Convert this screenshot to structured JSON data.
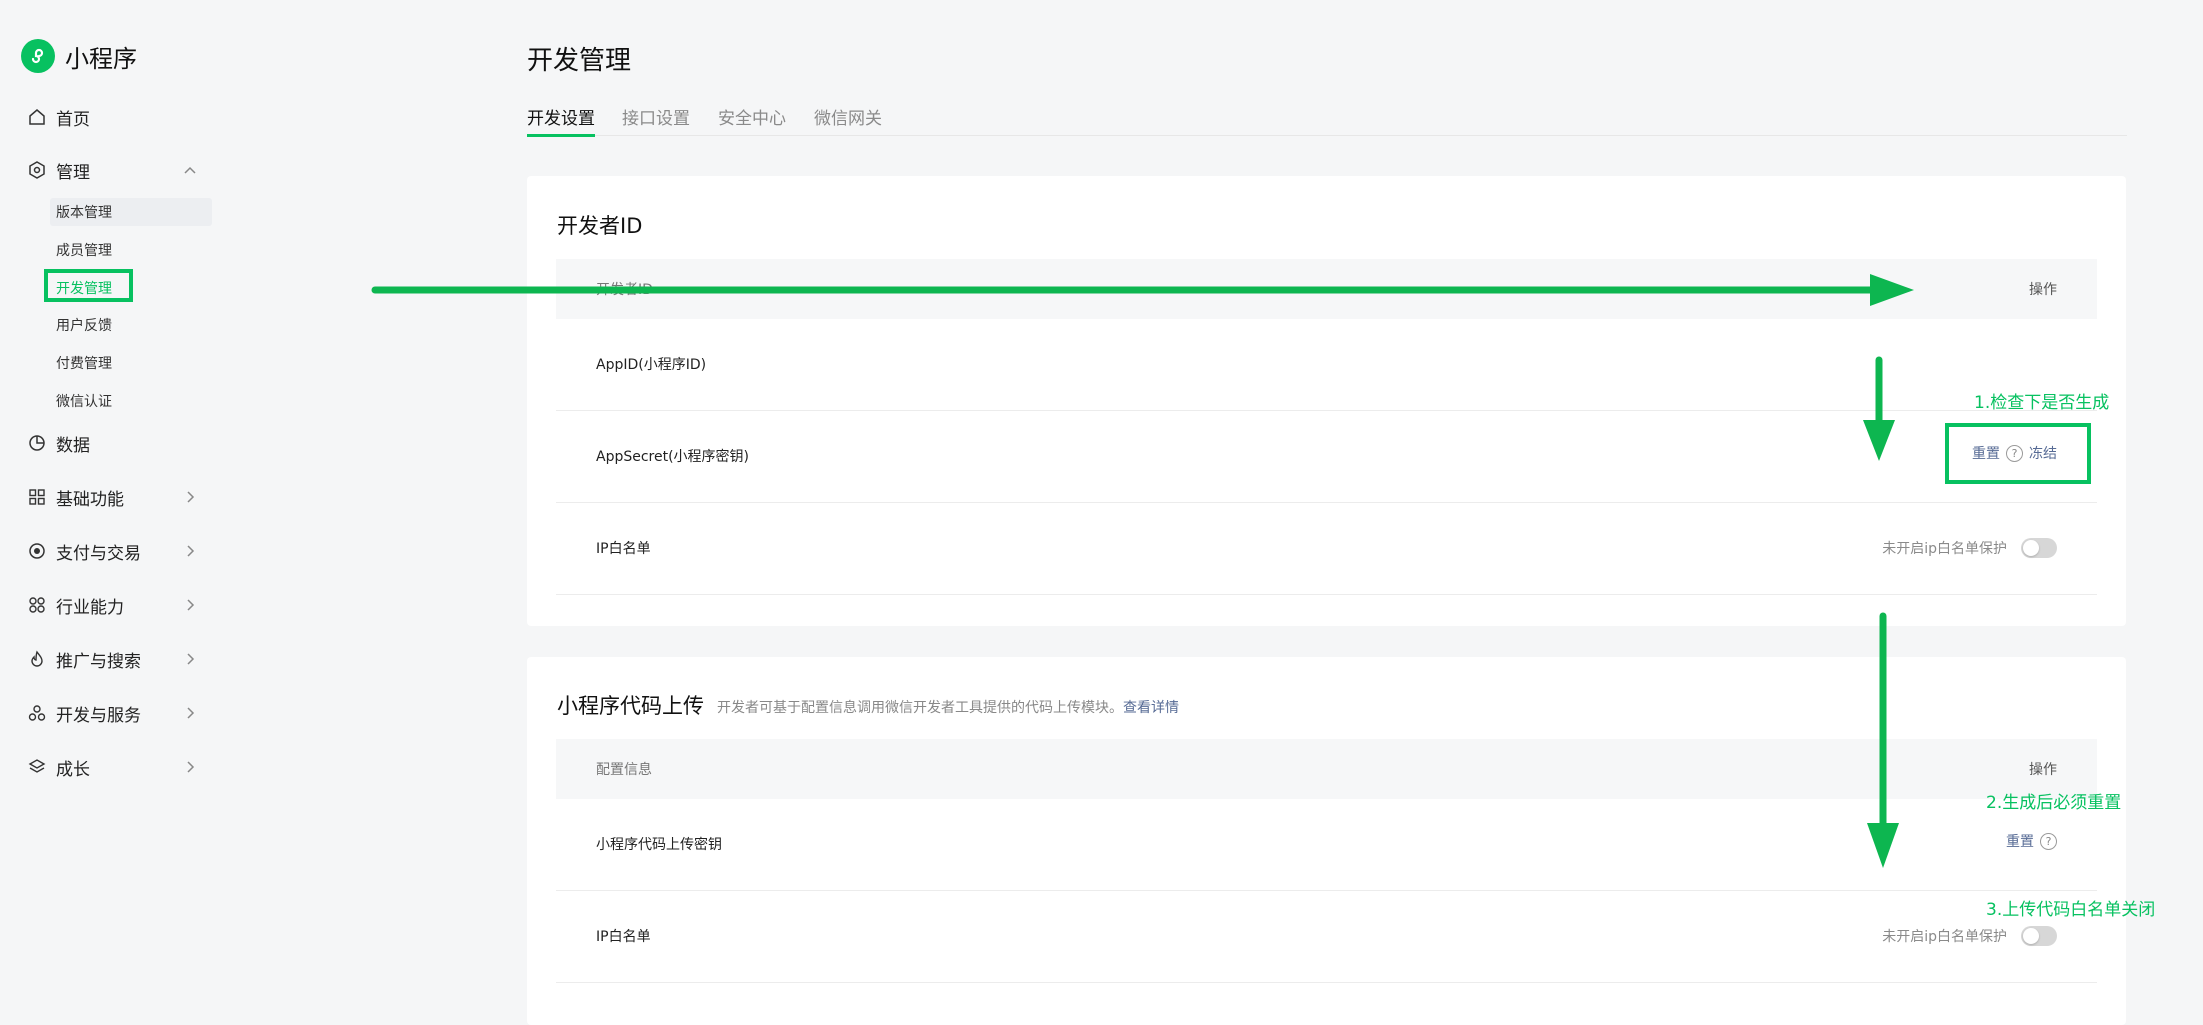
{
  "brand": {
    "name": "小程序"
  },
  "sidebar": {
    "items": [
      {
        "label": "首页",
        "icon": "home-icon"
      },
      {
        "label": "管理",
        "icon": "settings-hex-icon",
        "expanded": true
      },
      {
        "label": "数据",
        "icon": "pie-icon"
      },
      {
        "label": "基础功能",
        "icon": "grid-icon"
      },
      {
        "label": "支付与交易",
        "icon": "pay-icon"
      },
      {
        "label": "行业能力",
        "icon": "industry-icon"
      },
      {
        "label": "推广与搜索",
        "icon": "promote-icon"
      },
      {
        "label": "开发与服务",
        "icon": "dev-icon"
      },
      {
        "label": "成长",
        "icon": "growth-icon"
      }
    ],
    "sub_items": [
      "版本管理",
      "成员管理",
      "开发管理",
      "用户反馈",
      "付费管理",
      "微信认证"
    ]
  },
  "page": {
    "title": "开发管理"
  },
  "tabs": [
    "开发设置",
    "接口设置",
    "安全中心",
    "微信网关"
  ],
  "dev_id_card": {
    "title": "开发者ID",
    "header_left": "开发者ID",
    "header_right": "操作",
    "rows": [
      {
        "label": "AppID(小程序ID)"
      },
      {
        "label": "AppSecret(小程序密钥)",
        "reset": "重置",
        "help": "?",
        "freeze": "冻结"
      },
      {
        "label": "IP白名单",
        "status": "未开启ip白名单保护"
      }
    ]
  },
  "upload_card": {
    "title": "小程序代码上传",
    "desc": "开发者可基于配置信息调用微信开发者工具提供的代码上传模块。",
    "desc_link": "查看详情",
    "header_left": "配置信息",
    "header_right": "操作",
    "rows": [
      {
        "label": "小程序代码上传密钥",
        "reset": "重置",
        "help": "?"
      },
      {
        "label": "IP白名单",
        "status": "未开启ip白名单保护"
      }
    ]
  },
  "annotations": {
    "step1": "1.检查下是否生成",
    "step2": "2.生成后必须重置",
    "step3": "3.上传代码白名单关闭"
  },
  "colors": {
    "accent": "#07c160",
    "link": "#576b95"
  }
}
